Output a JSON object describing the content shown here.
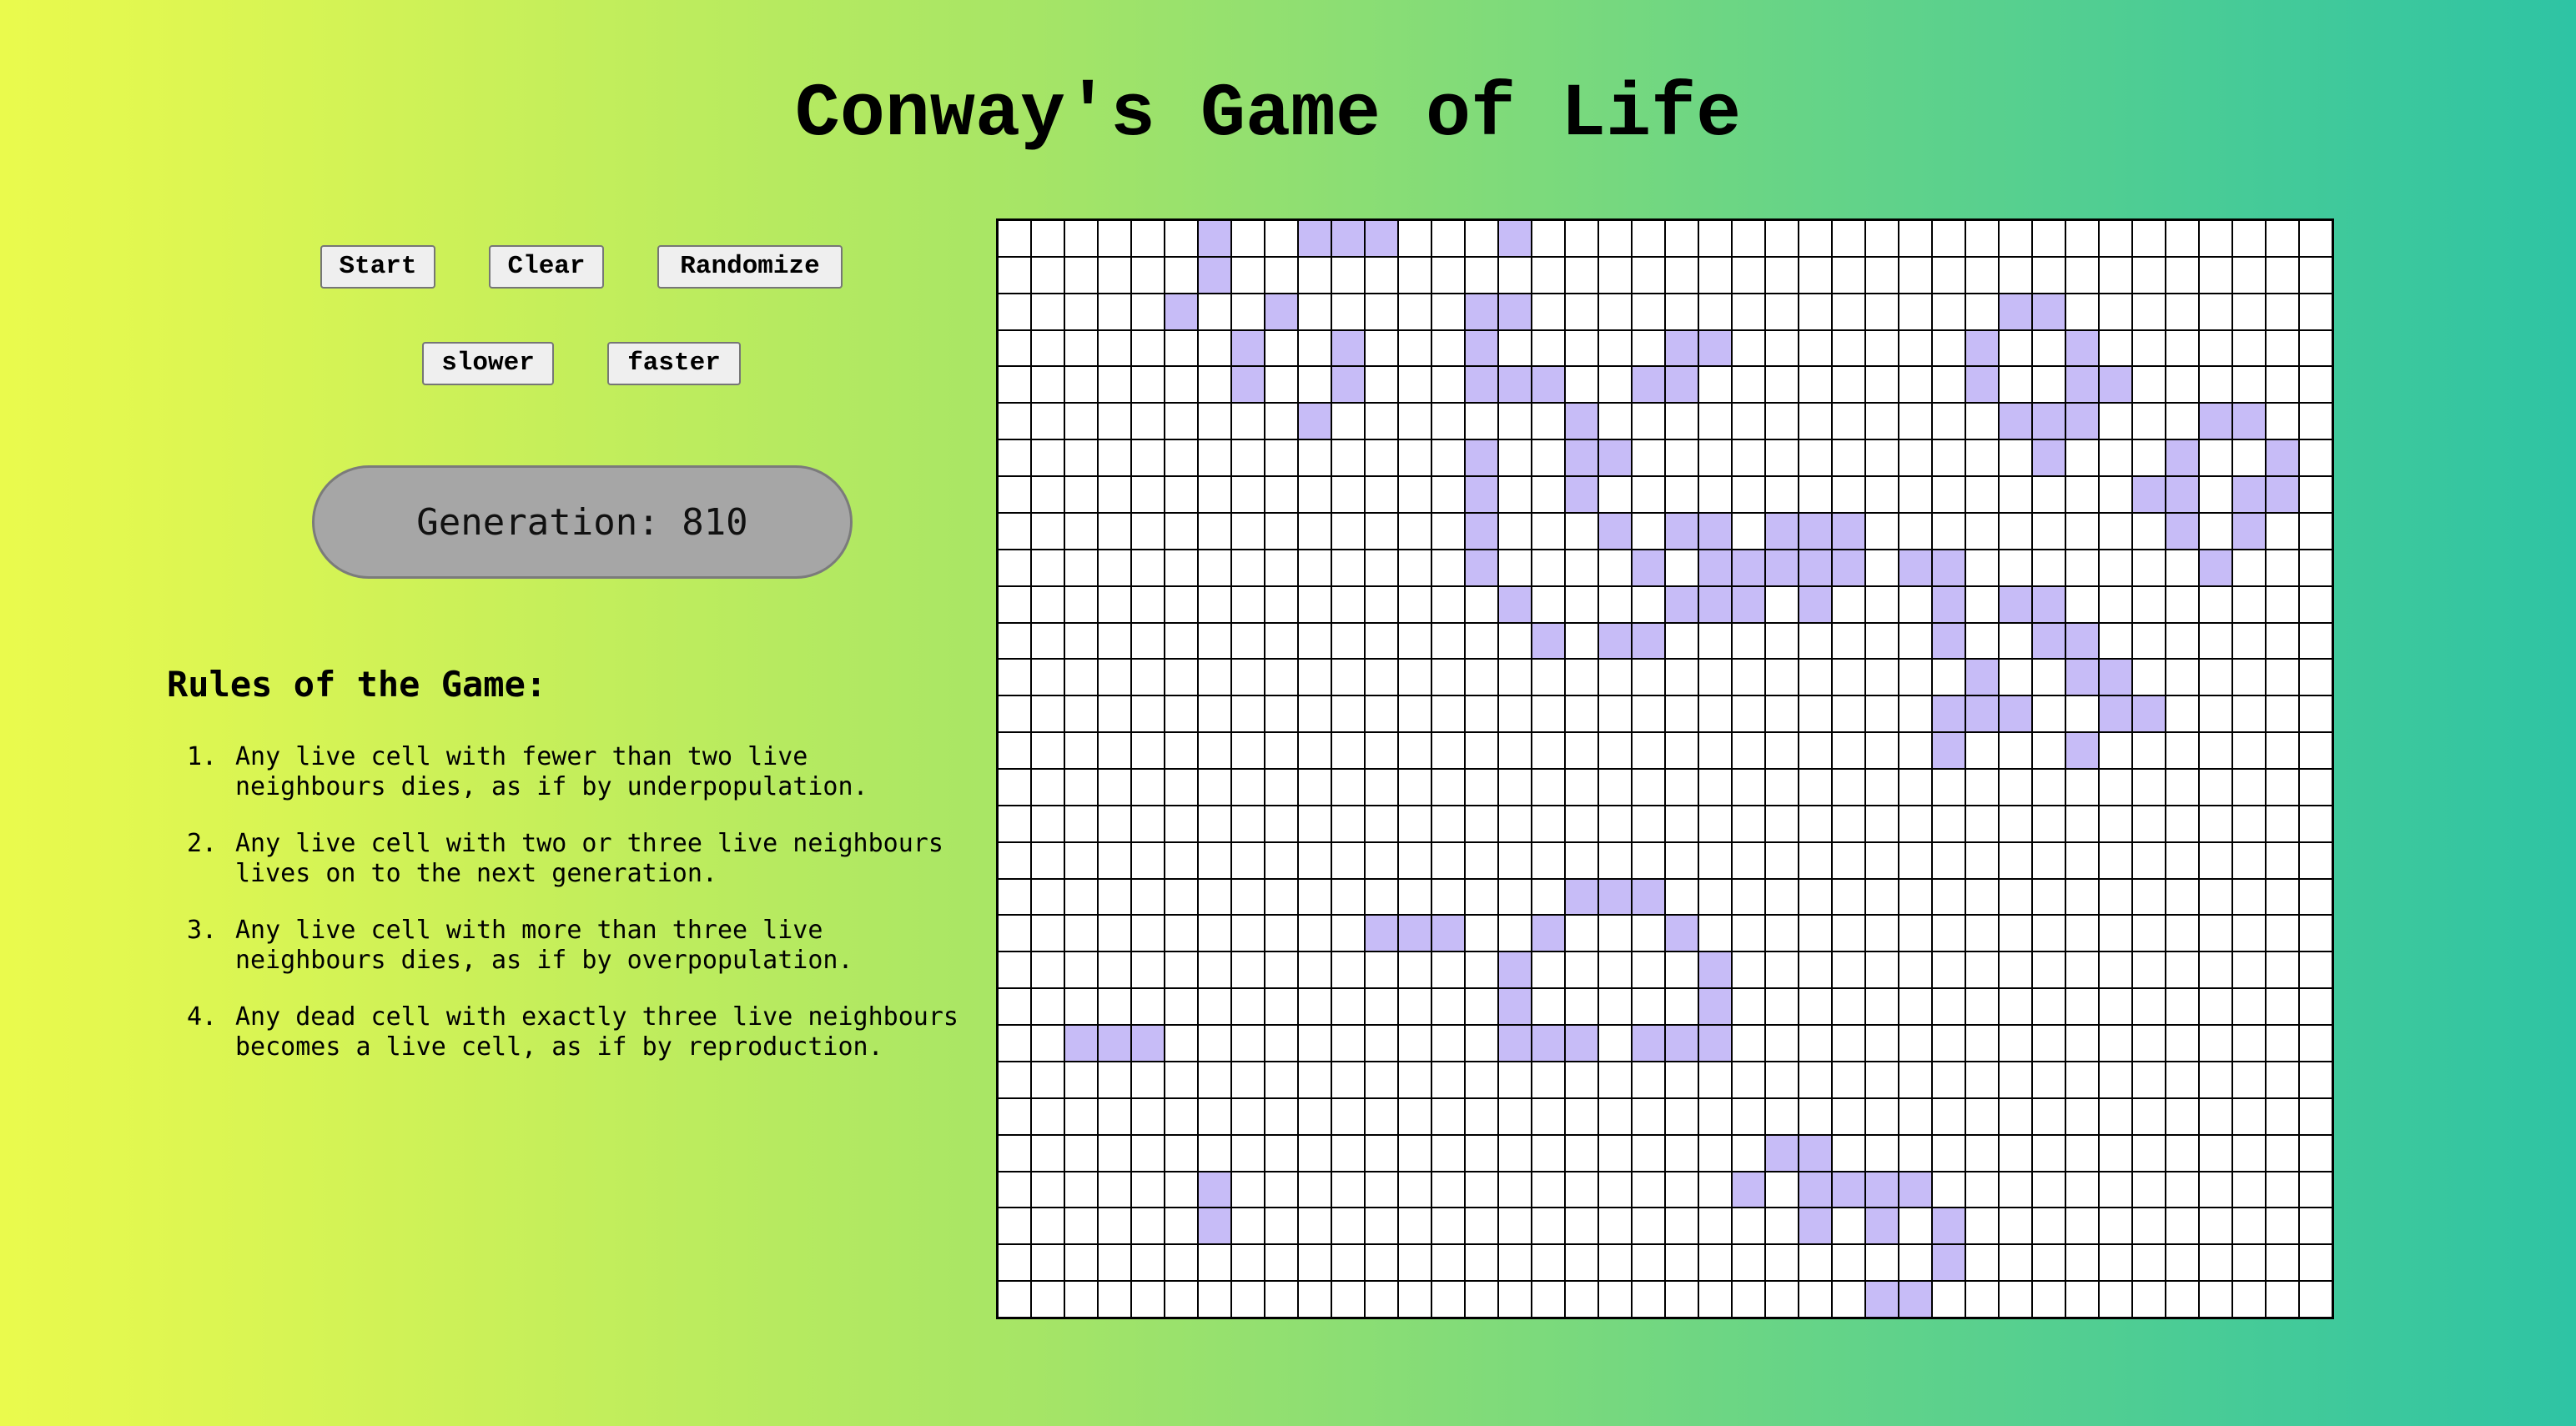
{
  "title": "Conway's Game of Life",
  "controls": {
    "start_label": "Start",
    "clear_label": "Clear",
    "randomize_label": "Randomize",
    "slower_label": "slower",
    "faster_label": "faster"
  },
  "generation": {
    "label": "Generation:",
    "value": "810"
  },
  "rules": {
    "title": "Rules of the Game:",
    "items": [
      {
        "num": "1.",
        "text": "Any live cell with fewer than two live neighbours dies, as if by underpopulation."
      },
      {
        "num": "2.",
        "text": "Any live cell with two or three live neighbours lives on to the next generation."
      },
      {
        "num": "3.",
        "text": "Any live cell with more than three live neighbours dies, as if by overpopulation."
      },
      {
        "num": "4.",
        "text": "Any dead cell with exactly three live neighbours becomes a live cell, as if by reproduction."
      }
    ]
  },
  "board": {
    "cols": 40,
    "rows": 30,
    "alive_color": "#c7bcf7",
    "dead_color": "#ffffff",
    "grid_color": "#000000",
    "alive_cells": [
      [
        0,
        6
      ],
      [
        0,
        9
      ],
      [
        0,
        10
      ],
      [
        0,
        11
      ],
      [
        0,
        15
      ],
      [
        1,
        6
      ],
      [
        2,
        5
      ],
      [
        2,
        8
      ],
      [
        2,
        14
      ],
      [
        2,
        15
      ],
      [
        2,
        30
      ],
      [
        2,
        31
      ],
      [
        3,
        7
      ],
      [
        3,
        10
      ],
      [
        3,
        14
      ],
      [
        3,
        20
      ],
      [
        3,
        21
      ],
      [
        3,
        29
      ],
      [
        3,
        32
      ],
      [
        4,
        7
      ],
      [
        4,
        10
      ],
      [
        4,
        14
      ],
      [
        4,
        15
      ],
      [
        4,
        16
      ],
      [
        4,
        19
      ],
      [
        4,
        20
      ],
      [
        4,
        29
      ],
      [
        4,
        32
      ],
      [
        4,
        33
      ],
      [
        5,
        9
      ],
      [
        5,
        17
      ],
      [
        5,
        30
      ],
      [
        5,
        31
      ],
      [
        5,
        32
      ],
      [
        5,
        36
      ],
      [
        5,
        37
      ],
      [
        6,
        14
      ],
      [
        6,
        17
      ],
      [
        6,
        18
      ],
      [
        6,
        31
      ],
      [
        6,
        35
      ],
      [
        6,
        38
      ],
      [
        7,
        14
      ],
      [
        7,
        17
      ],
      [
        7,
        34
      ],
      [
        7,
        35
      ],
      [
        7,
        37
      ],
      [
        7,
        38
      ],
      [
        8,
        14
      ],
      [
        8,
        18
      ],
      [
        8,
        20
      ],
      [
        8,
        21
      ],
      [
        8,
        23
      ],
      [
        8,
        24
      ],
      [
        8,
        25
      ],
      [
        8,
        35
      ],
      [
        8,
        37
      ],
      [
        9,
        14
      ],
      [
        9,
        19
      ],
      [
        9,
        21
      ],
      [
        9,
        22
      ],
      [
        9,
        23
      ],
      [
        9,
        24
      ],
      [
        9,
        25
      ],
      [
        9,
        27
      ],
      [
        9,
        28
      ],
      [
        9,
        36
      ],
      [
        10,
        15
      ],
      [
        10,
        20
      ],
      [
        10,
        21
      ],
      [
        10,
        22
      ],
      [
        10,
        24
      ],
      [
        10,
        28
      ],
      [
        10,
        30
      ],
      [
        10,
        31
      ],
      [
        11,
        16
      ],
      [
        11,
        18
      ],
      [
        11,
        19
      ],
      [
        11,
        28
      ],
      [
        11,
        31
      ],
      [
        11,
        32
      ],
      [
        12,
        29
      ],
      [
        12,
        32
      ],
      [
        12,
        33
      ],
      [
        13,
        28
      ],
      [
        13,
        29
      ],
      [
        13,
        30
      ],
      [
        13,
        33
      ],
      [
        13,
        34
      ],
      [
        14,
        28
      ],
      [
        14,
        32
      ],
      [
        18,
        17
      ],
      [
        18,
        18
      ],
      [
        18,
        19
      ],
      [
        19,
        11
      ],
      [
        19,
        12
      ],
      [
        19,
        13
      ],
      [
        19,
        16
      ],
      [
        19,
        20
      ],
      [
        20,
        15
      ],
      [
        20,
        21
      ],
      [
        21,
        15
      ],
      [
        21,
        21
      ],
      [
        22,
        2
      ],
      [
        22,
        3
      ],
      [
        22,
        4
      ],
      [
        22,
        15
      ],
      [
        22,
        16
      ],
      [
        22,
        17
      ],
      [
        22,
        19
      ],
      [
        22,
        20
      ],
      [
        22,
        21
      ],
      [
        25,
        23
      ],
      [
        25,
        24
      ],
      [
        26,
        6
      ],
      [
        26,
        22
      ],
      [
        26,
        24
      ],
      [
        26,
        25
      ],
      [
        26,
        26
      ],
      [
        26,
        27
      ],
      [
        27,
        6
      ],
      [
        27,
        24
      ],
      [
        27,
        26
      ],
      [
        27,
        28
      ],
      [
        28,
        28
      ],
      [
        29,
        26
      ],
      [
        29,
        27
      ]
    ]
  }
}
